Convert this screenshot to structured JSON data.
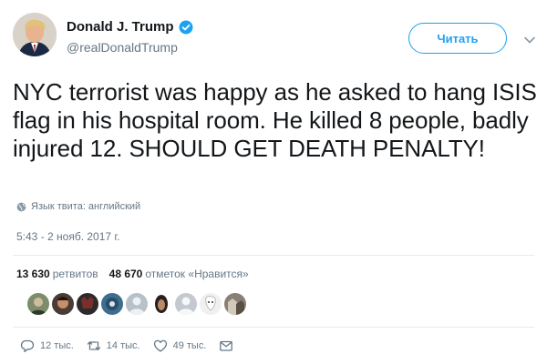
{
  "author": {
    "display_name": "Donald J. Trump",
    "handle": "@realDonaldTrump",
    "verified": true
  },
  "header": {
    "follow_label": "Читать"
  },
  "tweet": {
    "text": "NYC terrorist was happy as he asked to hang ISIS flag in his hospital room. He killed 8 people, badly injured 12. SHOULD GET DEATH PENALTY!",
    "language_note": "Язык твита: английский",
    "timestamp": "5:43 - 2 нояб. 2017 г."
  },
  "stats": {
    "retweets_count": "13 630",
    "retweets_label": "ретвитов",
    "likes_count": "48 670",
    "likes_label": "отметок «Нравится»"
  },
  "likers": [
    {
      "color": "#7d8c6a"
    },
    {
      "color": "#4a3b35"
    },
    {
      "color": "#2c2a2b"
    },
    {
      "color": "#3e6e8e"
    },
    {
      "color": "#b8c0c8"
    },
    {
      "color": "#2a1f1c"
    },
    {
      "color": "#c3c9cf"
    },
    {
      "color": "#f0f0f0"
    },
    {
      "color": "#8a7f74"
    }
  ],
  "actions": {
    "reply_count": "12 тыс.",
    "retweet_count": "14 тыс.",
    "like_count": "49 тыс."
  },
  "colors": {
    "accent": "#1da1f2",
    "text": "#14171a",
    "muted": "#657786"
  },
  "icons": [
    "verified-badge-icon",
    "chevron-down-icon",
    "globe-icon",
    "reply-icon",
    "retweet-icon",
    "heart-icon",
    "message-icon"
  ]
}
